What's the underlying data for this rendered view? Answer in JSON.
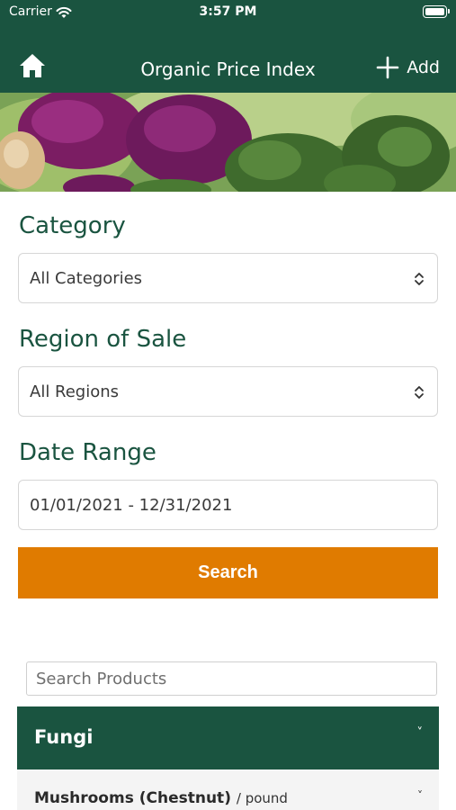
{
  "status_bar": {
    "carrier": "Carrier",
    "time": "3:57 PM"
  },
  "nav": {
    "title": "Organic Price Index",
    "add_label": "Add",
    "home_icon": "home-icon",
    "add_icon": "plus-icon"
  },
  "filters": {
    "category_label": "Category",
    "category_value": "All Categories",
    "region_label": "Region of Sale",
    "region_value": "All Regions",
    "date_label": "Date Range",
    "date_value": "01/01/2021 - 12/31/2021",
    "search_button": "Search"
  },
  "products": {
    "search_placeholder": "Search Products",
    "groups": [
      {
        "name": "Fungi",
        "items": [
          {
            "name": "Mushrooms (Chestnut)",
            "unit": "/ pound"
          }
        ]
      }
    ]
  },
  "colors": {
    "brand_green": "#1a5440",
    "accent_orange": "#e07b00"
  }
}
